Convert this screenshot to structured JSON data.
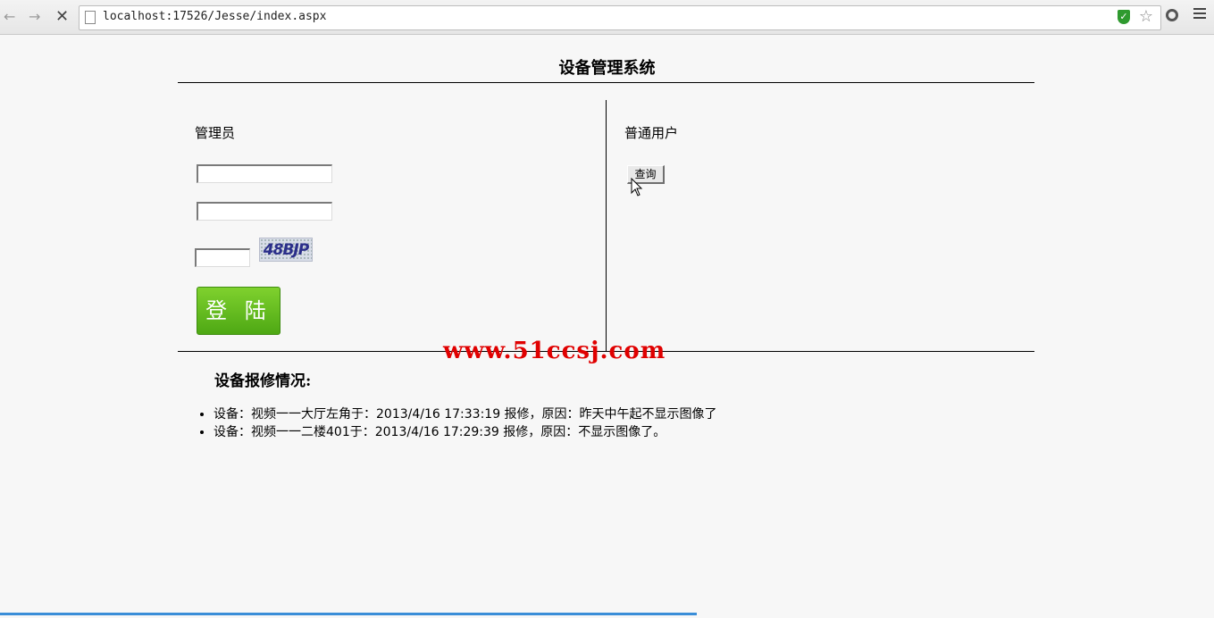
{
  "browser": {
    "url": "localhost:17526/Jesse/index.aspx",
    "icons": [
      "back-icon",
      "forward-icon",
      "stop-icon",
      "page-icon",
      "shield-icon",
      "star-icon",
      "extension-icon",
      "menu-icon"
    ]
  },
  "page": {
    "title": "设备管理系统"
  },
  "admin": {
    "label": "管理员",
    "username_value": "",
    "password_value": "",
    "code_value": "",
    "captcha_text": "48BJP",
    "login_label": "登 陆"
  },
  "user": {
    "label": "普通用户",
    "query_label": "查询"
  },
  "watermark": "www.51ccsj.com",
  "repairs": {
    "title": "设备报修情况:",
    "items": [
      "设备：视频一一大厅左角于：2013/4/16 17:33:19 报修，原因：昨天中午起不显示图像了",
      "设备：视频一一二楼401于：2013/4/16 17:29:39 报修，原因：不显示图像了。"
    ]
  },
  "colors": {
    "login_green": "#5cb81c",
    "watermark_red": "#e00000",
    "progress_blue": "#3a8ed8"
  }
}
